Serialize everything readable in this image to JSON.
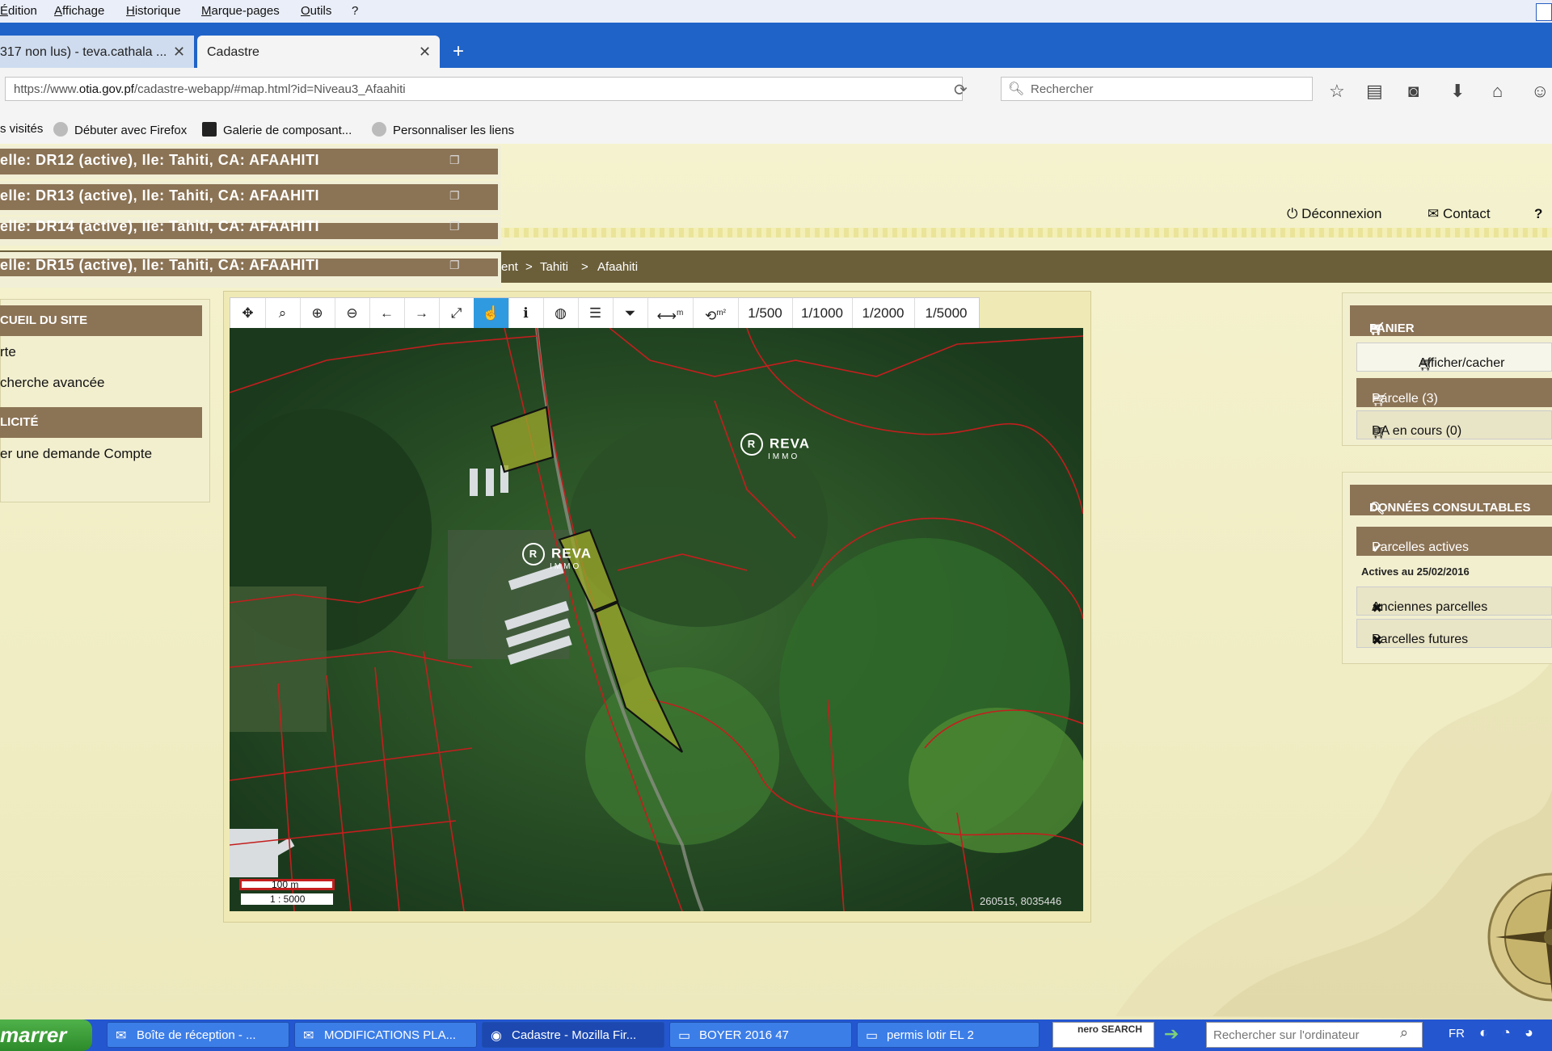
{
  "menu": [
    "Édition",
    "Affichage",
    "Historique",
    "Marque-pages",
    "Outils",
    "?"
  ],
  "tabs": [
    {
      "label": "317 non lus) - teva.cathala ..."
    },
    {
      "label": "Cadastre"
    }
  ],
  "url": {
    "prefix": "https://www.",
    "domain": "otia.gov.pf",
    "path": "/cadastre-webapp/#map.html?id=Niveau3_Afaahiti"
  },
  "search": {
    "placeholder": "Rechercher"
  },
  "bookmarks": [
    "s visités",
    "Débuter avec Firefox",
    "Galerie de composant...",
    "Personnaliser les liens"
  ],
  "header_links": {
    "logout": "Déconnexion",
    "contact": "Contact"
  },
  "breadcrumb": [
    "ent",
    ">",
    "Tahiti",
    ">",
    "Afaahiti"
  ],
  "parcel_list": [
    "elle: DR12 (active), Ile: Tahiti, CA: AFAAHITI",
    "elle: DR13 (active), Ile: Tahiti, CA: AFAAHITI",
    "elle: DR14 (active), Ile: Tahiti, CA: AFAAHITI",
    "elle: DR15 (active), Ile: Tahiti, CA: AFAAHITI"
  ],
  "left_panel": {
    "header1": "CUEIL DU SITE",
    "links1": [
      "rte",
      "cherche avancée"
    ],
    "header2": "LICITÉ",
    "links2": [
      "er une demande Compte"
    ]
  },
  "toolbar": {
    "scales": [
      "1/500",
      "1/1000",
      "1/2000",
      "1/5000"
    ],
    "measure_m": "m",
    "measure_m2": "m²"
  },
  "map": {
    "watermark": "REVA",
    "watermark_sub": "IMMO",
    "watermark_logo": "R",
    "scale_distance": "100 m",
    "scale_ratio": "1 : 5000",
    "coordinates": "260515, 8035446"
  },
  "basket": {
    "header": "PANIER",
    "toggle": "Afficher/cacher",
    "parcel": "Parcelle (3)",
    "da": "DA en cours (0)"
  },
  "data_panel": {
    "header": "DONNÉES CONSULTABLES",
    "active": "Parcelles actives",
    "active_date": "Actives au 25/02/2016",
    "old": "Anciennes parcelles",
    "future": "Parcelles futures"
  },
  "taskbar": {
    "start": "marrer",
    "items": [
      "Boîte de réception - ...",
      "MODIFICATIONS PLA...",
      "Cadastre - Mozilla Fir...",
      "BOYER 2016 47",
      "permis lotir EL 2"
    ],
    "nero": "nero SEARCH",
    "search_placeholder": "Rechercher sur l'ordinateur",
    "lang": "FR"
  },
  "colors": {
    "panel_header": "#8b7355",
    "breadcrumb_bar": "#6b5f3a",
    "tab_bar": "#1f63c8",
    "taskbar": "#2456d0",
    "parcel_fill": "#9aa52a"
  }
}
